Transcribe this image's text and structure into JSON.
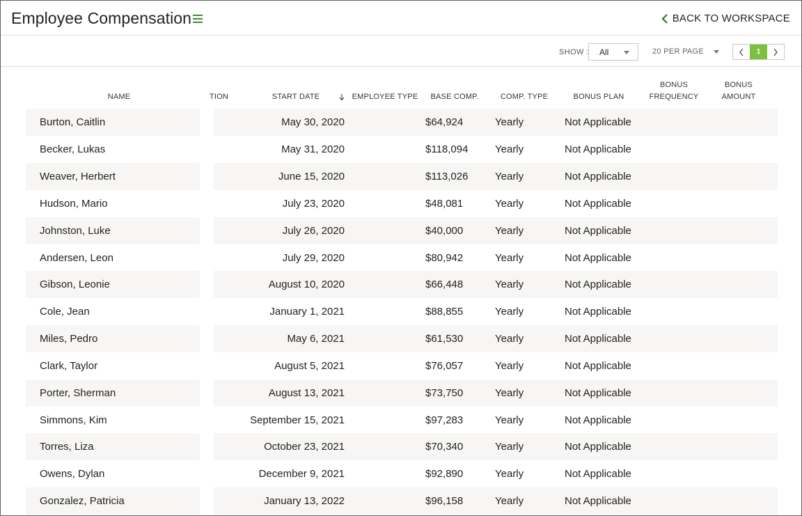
{
  "header": {
    "title": "Employee Compensation",
    "back_label": "BACK TO WORKSPACE"
  },
  "toolbar": {
    "show_label": "SHOW :",
    "show_value": "All",
    "per_page": "20 PER PAGE",
    "current_page": "1"
  },
  "columns": {
    "name": "NAME",
    "position_partial": "TION",
    "start_date": "START DATE",
    "employee_type": "EMPLOYEE TYPE",
    "base_comp": "BASE COMP.",
    "comp_type": "COMP. TYPE",
    "bonus_plan": "BONUS PLAN",
    "bonus_frequency_1": "BONUS",
    "bonus_frequency_2": "FREQUENCY",
    "bonus_amount_1": "BONUS",
    "bonus_amount_2": "AMOUNT"
  },
  "rows": [
    {
      "name": "Burton, Caitlin",
      "start_date": "May 30, 2020",
      "base_comp": "$64,924",
      "comp_type": "Yearly",
      "bonus_plan": "Not Applicable"
    },
    {
      "name": "Becker, Lukas",
      "start_date": "May 31, 2020",
      "base_comp": "$118,094",
      "comp_type": "Yearly",
      "bonus_plan": "Not Applicable"
    },
    {
      "name": "Weaver, Herbert",
      "start_date": "June 15, 2020",
      "base_comp": "$113,026",
      "comp_type": "Yearly",
      "bonus_plan": "Not Applicable"
    },
    {
      "name": "Hudson, Mario",
      "start_date": "July 23, 2020",
      "base_comp": "$48,081",
      "comp_type": "Yearly",
      "bonus_plan": "Not Applicable"
    },
    {
      "name": "Johnston, Luke",
      "start_date": "July 26, 2020",
      "base_comp": "$40,000",
      "comp_type": "Yearly",
      "bonus_plan": "Not Applicable"
    },
    {
      "name": "Andersen, Leon",
      "start_date": "July 29, 2020",
      "base_comp": "$80,942",
      "comp_type": "Yearly",
      "bonus_plan": "Not Applicable"
    },
    {
      "name": "Gibson, Leonie",
      "start_date": "August 10, 2020",
      "base_comp": "$66,448",
      "comp_type": "Yearly",
      "bonus_plan": "Not Applicable"
    },
    {
      "name": "Cole, Jean",
      "start_date": "January 1, 2021",
      "base_comp": "$88,855",
      "comp_type": "Yearly",
      "bonus_plan": "Not Applicable"
    },
    {
      "name": "Miles, Pedro",
      "start_date": "May 6, 2021",
      "base_comp": "$61,530",
      "comp_type": "Yearly",
      "bonus_plan": "Not Applicable"
    },
    {
      "name": "Clark, Taylor",
      "start_date": "August 5, 2021",
      "base_comp": "$76,057",
      "comp_type": "Yearly",
      "bonus_plan": "Not Applicable"
    },
    {
      "name": "Porter, Sherman",
      "start_date": "August 13, 2021",
      "base_comp": "$73,750",
      "comp_type": "Yearly",
      "bonus_plan": "Not Applicable"
    },
    {
      "name": "Simmons, Kim",
      "start_date": "September 15, 2021",
      "base_comp": "$97,283",
      "comp_type": "Yearly",
      "bonus_plan": "Not Applicable"
    },
    {
      "name": "Torres, Liza",
      "start_date": "October 23, 2021",
      "base_comp": "$70,340",
      "comp_type": "Yearly",
      "bonus_plan": "Not Applicable"
    },
    {
      "name": "Owens, Dylan",
      "start_date": "December 9, 2021",
      "base_comp": "$92,890",
      "comp_type": "Yearly",
      "bonus_plan": "Not Applicable"
    },
    {
      "name": "Gonzalez, Patricia",
      "start_date": "January 13, 2022",
      "base_comp": "$96,158",
      "comp_type": "Yearly",
      "bonus_plan": "Not Applicable"
    }
  ],
  "colors": {
    "accent": "#3e8a2e",
    "page_active": "#7cc13e",
    "row_shade": "#f7f6f4"
  },
  "icons": {
    "menu": "hamburger-icon",
    "back": "chevron-left-icon",
    "sort": "arrow-down-icon",
    "prev": "chevron-left-icon",
    "next": "chevron-right-icon"
  }
}
